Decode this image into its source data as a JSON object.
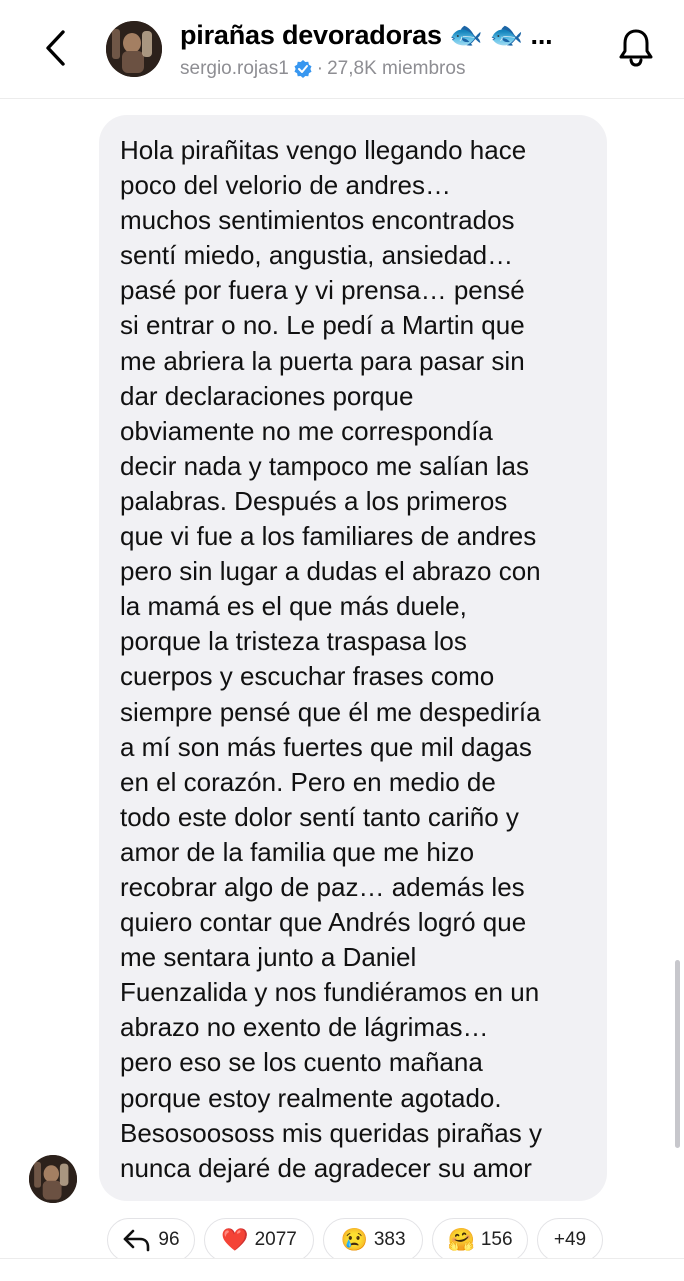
{
  "header": {
    "title": "pirañas devoradoras 🐟 🐟 ...",
    "username": "sergio.rojas1",
    "separator": "·",
    "members": "27,8K miembros"
  },
  "message": {
    "lines": [
      "Hola pirañitas vengo llegando hace",
      "poco del velorio de andres…",
      "muchos sentimientos encontrados",
      "sentí miedo, angustia, ansiedad…",
      "pasé por fuera y vi prensa… pensé",
      "si entrar o no. Le pedí a Martin que",
      "me abriera la puerta  para pasar sin",
      "dar declaraciones porque",
      "obviamente no me correspondía",
      "decir nada y tampoco me salían las",
      "palabras. Después a los primeros",
      "que vi fue a los familiares de andres",
      "pero sin lugar a dudas el abrazo con",
      "la mamá es el que más duele,",
      "porque la tristeza traspasa los",
      "cuerpos y escuchar frases como",
      "siempre pensé que él me despediría",
      "a mí son más fuertes que mil dagas",
      "en el corazón. Pero en medio de",
      "todo este dolor sentí tanto cariño y",
      "amor de la familia que me hizo",
      "recobrar algo de paz… además les",
      "quiero contar que Andrés logró que",
      "me sentara junto a Daniel",
      "Fuenzalida y nos fundiéramos en un",
      "abrazo no exento de lágrimas…",
      "pero eso se los cuento mañana",
      "porque estoy realmente agotado.",
      "Besosoososs mis queridas pirañas y",
      "nunca dejaré de agradecer su amor"
    ]
  },
  "reactions": {
    "replies": "96",
    "heart": {
      "emoji": "❤️",
      "count": "2077"
    },
    "cry": {
      "emoji": "😢",
      "count": "383"
    },
    "hug": {
      "emoji": "🤗",
      "count": "156"
    },
    "more": "+49"
  },
  "icons": {
    "back": "chevron-left-icon",
    "bell": "bell-icon",
    "verified": "verified-badge-icon",
    "reply": "reply-arrow-icon"
  },
  "colors": {
    "bubble": "#f1f1f4",
    "verified": "#3897f0",
    "subtle_text": "#8e8e93"
  }
}
